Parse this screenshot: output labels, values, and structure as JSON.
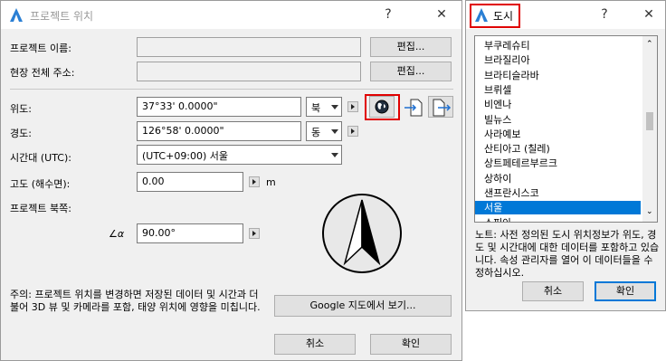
{
  "project_dialog": {
    "title": "프로젝트 위치",
    "help_glyph": "?",
    "close_glyph": "✕",
    "project_name_label": "프로젝트 이름:",
    "project_name_value": "",
    "edit_button_1": "편집...",
    "site_address_label": "현장 전체 주소:",
    "site_address_value": "",
    "edit_button_2": "편집...",
    "latitude_label": "위도:",
    "latitude_value": "37°33' 0.0000\"",
    "latitude_dir": "북",
    "longitude_label": "경도:",
    "longitude_value": "126°58' 0.0000\"",
    "longitude_dir": "동",
    "timezone_label": "시간대 (UTC):",
    "timezone_value": "(UTC+09:00) 서울",
    "altitude_label": "고도 (해수면):",
    "altitude_value": "0.00",
    "altitude_unit": "m",
    "north_label": "프로젝트 북쪽:",
    "north_value": "90.00°",
    "north_angle_glyph": "∠α",
    "note_text": "주의: 프로젝트 위치를 변경하면 저장된 데이터 및 시간과 더불어 3D 뷰 및 카메라를 포함, 태양 위치에 영향을 미칩니다.",
    "google_map_button": "Google 지도에서 보기...",
    "cancel_button": "취소",
    "ok_button": "확인"
  },
  "city_dialog": {
    "title": "도시",
    "help_glyph": "?",
    "close_glyph": "✕",
    "cities": [
      "부쿠레슈티",
      "브라질리아",
      "브라티슬라바",
      "브뤼셀",
      "비엔나",
      "빌뉴스",
      "사라예보",
      "산티아고 (칠레)",
      "상트페테르부르크",
      "상하이",
      "샌프란시스코",
      "서울",
      "소피아"
    ],
    "selected_city": "서울",
    "note_text": "노트: 사전 정의된 도시 위치정보가 위도, 경도 및 시간대에 대한 데이터를 포함하고 있습니다. 속성 관리자를 열어 이 데이터들을 수정하십시오.",
    "cancel_button": "취소",
    "ok_button": "확인"
  },
  "colors": {
    "highlight": "#e00000",
    "selection": "#0078d7",
    "app_icon": "#2a7fd4"
  },
  "icons": [
    "archicad-app-icon",
    "globe-icon",
    "apply-arrow-icon",
    "export-arrow-icon",
    "north-compass-icon",
    "angle-icon"
  ]
}
